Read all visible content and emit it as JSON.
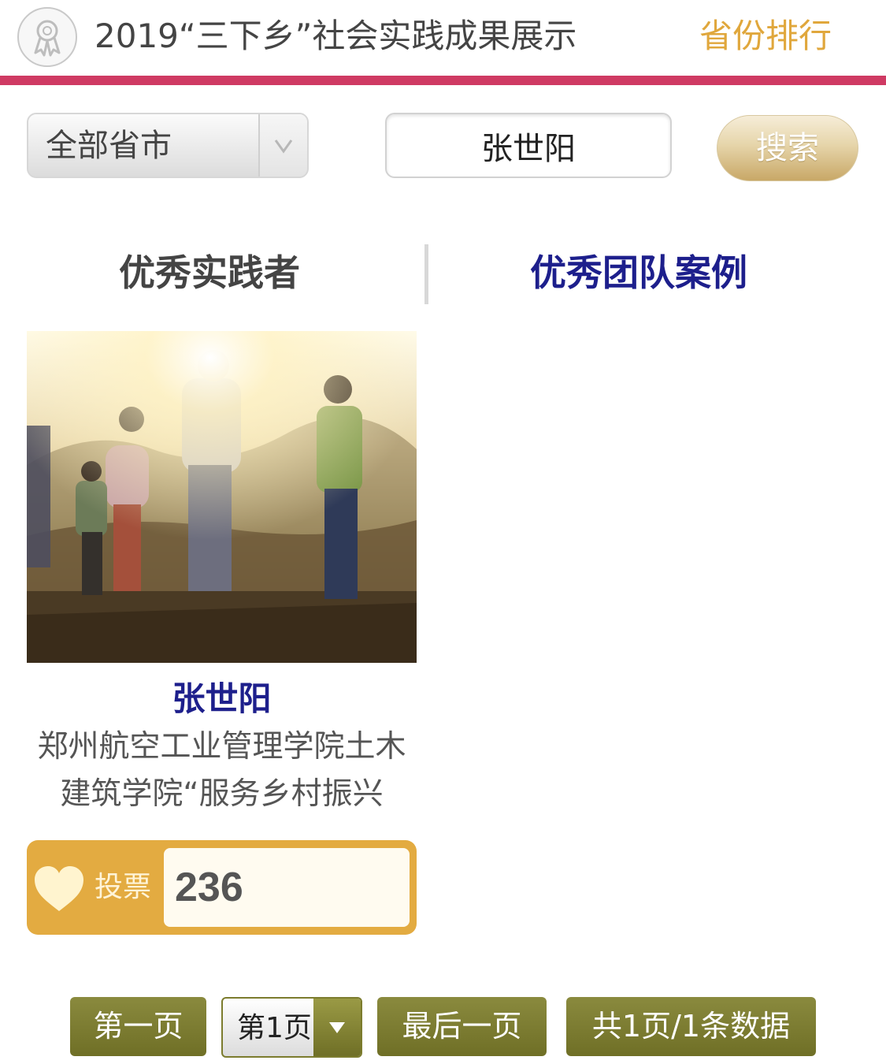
{
  "header": {
    "title": "2019“三下乡”社会实践成果展示",
    "rank_link": "省份排行",
    "logo_icon": "award-ribbon-icon"
  },
  "filters": {
    "province_select": {
      "selected": "全部省市",
      "arrow_icon": "chevron-down-icon"
    },
    "search": {
      "value": "张世阳",
      "button_label": "搜索"
    }
  },
  "tabs": [
    {
      "label": "优秀实践者",
      "active": false
    },
    {
      "label": "优秀团队案例",
      "active": true
    }
  ],
  "results": [
    {
      "name": "张世阳",
      "description": "郑州航空工业管理学院土木建筑学院“服务乡村振兴",
      "vote_label": "投票",
      "vote_count": "236",
      "heart_icon": "heart-icon",
      "photo": "children-walking-countryside-photo"
    }
  ],
  "pagination": {
    "first": "第一页",
    "current": "第1页",
    "last": "最后一页",
    "summary": "共1页/1条数据"
  },
  "colors": {
    "accent_bar": "#cf3a63",
    "gold": "#e3ab41",
    "navy": "#1d1f8c",
    "olive": "#7c7c2e"
  }
}
